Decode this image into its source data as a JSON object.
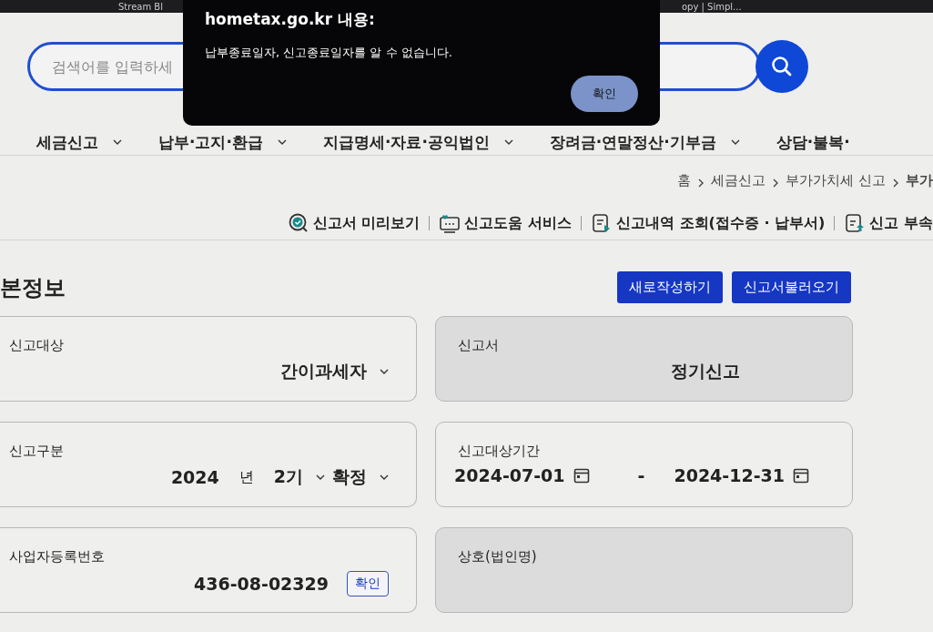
{
  "browser_bar": {
    "bookmarks": [
      "Stream Bl",
      "opy | Simpl..."
    ]
  },
  "search": {
    "placeholder": "검색어를 입력하세"
  },
  "nav": [
    {
      "label": "세금신고"
    },
    {
      "label": "납부·고지·환급"
    },
    {
      "label": "지급명세·자료·공익법인"
    },
    {
      "label": "장려금·연말정산·기부금"
    },
    {
      "label": "상담·불복·"
    }
  ],
  "breadcrumb": [
    "홈",
    "세금신고",
    "부가가치세 신고",
    "부가"
  ],
  "toolbar": [
    {
      "label": "신고서 미리보기",
      "kind": "preview"
    },
    {
      "label": "신고도움 서비스",
      "kind": "help"
    },
    {
      "label": "신고내역 조회(접수증 · 납부서)",
      "kind": "history"
    },
    {
      "label": "신고 부속",
      "kind": "attach"
    }
  ],
  "section": {
    "title": "본정보",
    "buttons": [
      "새로작성하기",
      "신고서불러오기"
    ]
  },
  "fields": [
    {
      "label": "신고대상",
      "kind": "select",
      "disabled": false,
      "parts": [
        {
          "text": "간이과세자",
          "dropdown": true
        }
      ]
    },
    {
      "label": "신고서",
      "kind": "text",
      "disabled": true,
      "parts": [
        {
          "text": "정기신고",
          "dropdown": false
        }
      ]
    },
    {
      "label": "신고구분",
      "kind": "select",
      "disabled": false,
      "parts": [
        {
          "text": "2024",
          "dropdown": false
        },
        {
          "text": "년",
          "dropdown": false
        },
        {
          "text": "2기",
          "dropdown": true
        },
        {
          "text": "확정",
          "dropdown": true
        }
      ]
    },
    {
      "label": "신고대상기간",
      "kind": "dates",
      "disabled": false,
      "parts": [
        {
          "text": "2024-07-01",
          "dropdown": false
        },
        {
          "text": "-",
          "dropdown": false
        },
        {
          "text": "2024-12-31",
          "dropdown": false
        }
      ]
    },
    {
      "label": "사업자등록번호",
      "kind": "check",
      "disabled": false,
      "parts": [
        {
          "text": "436-08-02329",
          "dropdown": false
        }
      ],
      "button": "확인"
    },
    {
      "label": "상호(법인명)",
      "kind": "text",
      "disabled": true
    }
  ],
  "dialog": {
    "title": "hometax.go.kr 내용:",
    "message": "납부종료일자, 신고종료일자를 알 수 없습니다.",
    "button": "확인"
  }
}
